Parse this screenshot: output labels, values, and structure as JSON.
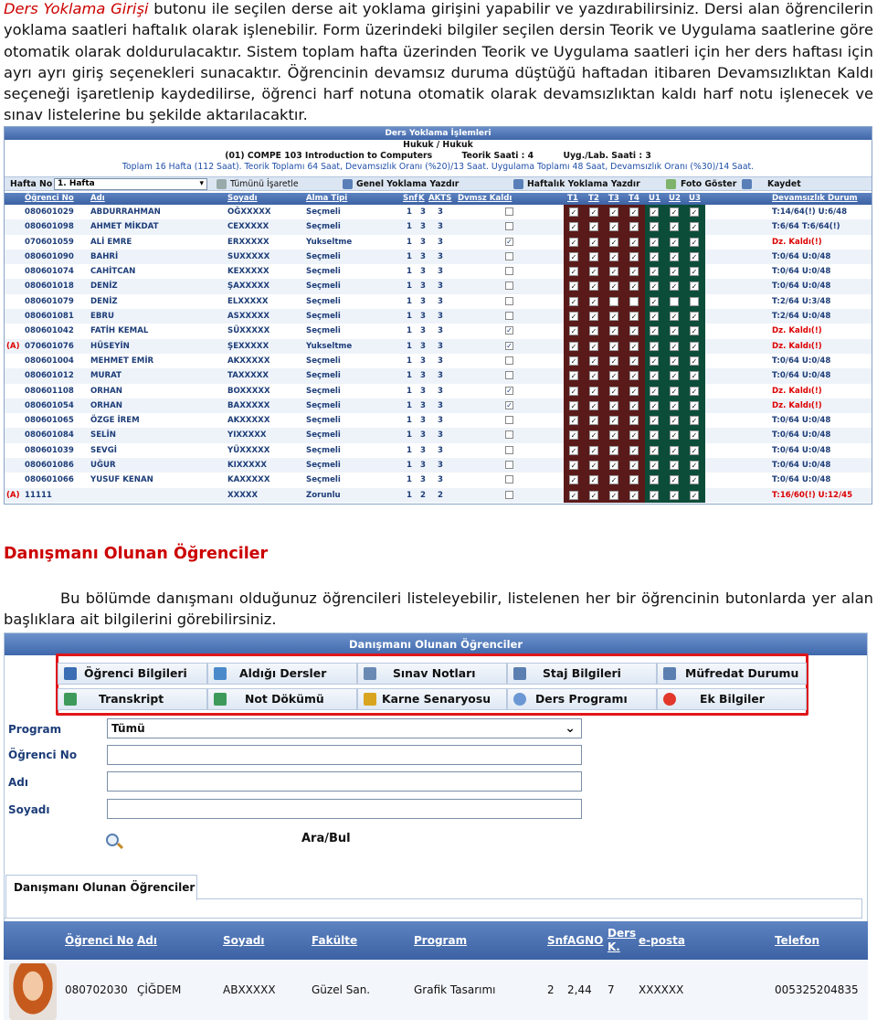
{
  "intro": {
    "lead_red": "Ders Yoklama Girişi",
    "text": " butonu ile seçilen derse ait yoklama girişini yapabilir ve yazdırabilirsiniz. Dersi alan öğrencilerin yoklama saatleri haftalık olarak işlenebilir. Form üzerindeki bilgiler seçilen dersin Teorik ve Uygulama saatlerine göre otomatik olarak doldurulacaktır. Sistem toplam hafta üzerinden Teorik ve Uygulama saatleri için her ders haftası için ayrı ayrı giriş seçenekleri sunacaktır. Öğrencinin devamsız duruma düştüğü haftadan itibaren Devamsızlıktan Kaldı seçeneği işaretlenip kaydedilirse, öğrenci harf notuna otomatik olarak devamsızlıktan kaldı harf notu işlenecek ve sınav listelerine bu şekilde aktarılacaktır."
  },
  "attendance_form": {
    "header": "Ders Yoklama İşlemleri",
    "line1": "Hukuk / Hukuk",
    "line2a": "(01) COMPE 103 Introduction to Computers",
    "line2b": "Teorik Saati : 4",
    "line2c": "Uyg./Lab. Saati : 3",
    "line3": "Toplam 16 Hafta (112 Saat). Teorik Toplamı 64 Saat, Devamsızlık Oranı (%20)/13 Saat. Uygulama Toplamı 48 Saat, Devamsızlık Oranı (%30)/14 Saat.",
    "week_label": "Hafta No",
    "week_value": "1. Hafta",
    "toolbar": {
      "mark_all": "Tümünü İşaretle",
      "general_print": "Genel Yoklama Yazdır",
      "weekly_print": "Haftalık Yoklama Yazdır",
      "photo": "Foto Göster",
      "save": "Kaydet"
    },
    "columns": {
      "no": "Öğrenci No",
      "name": "Adı",
      "surname": "Soyadı",
      "take_type": "Alma Tipi",
      "snf": "Snf",
      "k": "K",
      "akts": "AKTS",
      "dvmsz": "Dvmsz Kaldı",
      "t1": "T1",
      "t2": "T2",
      "t3": "T3",
      "t4": "T4",
      "u1": "U1",
      "u2": "U2",
      "u3": "U3",
      "status": "Devamsızlık Durum"
    },
    "rows": [
      {
        "no": "080601029",
        "name": "ABDURRAHMAN",
        "surname": "OĞXXXXX",
        "type": "Seçmeli",
        "snf": "1",
        "k": "3",
        "akts": "3",
        "dk": false,
        "checks": [
          1,
          1,
          1,
          1,
          1,
          1,
          1
        ],
        "status": "T:14/64(!) U:6/48",
        "red": false
      },
      {
        "no": "080601098",
        "name": "AHMET MİKDAT",
        "surname": "CEXXXXX",
        "type": "Seçmeli",
        "snf": "1",
        "k": "3",
        "akts": "3",
        "dk": false,
        "checks": [
          1,
          1,
          1,
          1,
          1,
          1,
          1
        ],
        "status": "T:6/64 T:6/64(!)",
        "red": false
      },
      {
        "no": "070601059",
        "name": "ALİ EMRE",
        "surname": "ERXXXXX",
        "type": "Yukseltme",
        "snf": "1",
        "k": "3",
        "akts": "3",
        "dk": true,
        "checks": [
          1,
          1,
          1,
          1,
          1,
          1,
          1
        ],
        "status": "Dz. Kaldı(!)",
        "red": true
      },
      {
        "no": "080601090",
        "name": "BAHRİ",
        "surname": "SUXXXXX",
        "type": "Seçmeli",
        "snf": "1",
        "k": "3",
        "akts": "3",
        "dk": false,
        "checks": [
          1,
          1,
          1,
          1,
          1,
          1,
          1
        ],
        "status": "T:0/64 U:0/48",
        "red": false
      },
      {
        "no": "080601074",
        "name": "CAHİTCAN",
        "surname": "KEXXXXX",
        "type": "Seçmeli",
        "snf": "1",
        "k": "3",
        "akts": "3",
        "dk": false,
        "checks": [
          1,
          1,
          1,
          1,
          1,
          1,
          1
        ],
        "status": "T:0/64 U:0/48",
        "red": false
      },
      {
        "no": "080601018",
        "name": "DENİZ",
        "surname": "ŞAXXXXX",
        "type": "Seçmeli",
        "snf": "1",
        "k": "3",
        "akts": "3",
        "dk": false,
        "checks": [
          1,
          1,
          1,
          1,
          1,
          1,
          1
        ],
        "status": "T:0/64 U:0/48",
        "red": false
      },
      {
        "no": "080601079",
        "name": "DENİZ",
        "surname": "ELXXXXX",
        "type": "Seçmeli",
        "snf": "1",
        "k": "3",
        "akts": "3",
        "dk": false,
        "checks": [
          1,
          1,
          0,
          0,
          1,
          0,
          0
        ],
        "status": "T:2/64 U:3/48",
        "red": false
      },
      {
        "no": "080601081",
        "name": "EBRU",
        "surname": "ASXXXXX",
        "type": "Seçmeli",
        "snf": "1",
        "k": "3",
        "akts": "3",
        "dk": false,
        "checks": [
          1,
          1,
          1,
          1,
          1,
          1,
          1
        ],
        "status": "T:2/64 U:0/48",
        "red": false
      },
      {
        "no": "080601042",
        "name": "FATİH KEMAL",
        "surname": "SÜXXXXX",
        "type": "Seçmeli",
        "snf": "1",
        "k": "3",
        "akts": "3",
        "dk": true,
        "checks": [
          1,
          1,
          1,
          1,
          1,
          1,
          1
        ],
        "status": "Dz. Kaldı(!)",
        "red": true
      },
      {
        "no": "070601076",
        "name": "HÜSEYİN",
        "surname": "ŞEXXXXX",
        "type": "Yukseltme",
        "snf": "1",
        "k": "3",
        "akts": "3",
        "dk": true,
        "checks": [
          1,
          1,
          1,
          1,
          1,
          1,
          1
        ],
        "status": "Dz. Kaldı(!)",
        "red": true,
        "prefix": "(A) "
      },
      {
        "no": "080601004",
        "name": "MEHMET EMİR",
        "surname": "AKXXXXX",
        "type": "Seçmeli",
        "snf": "1",
        "k": "3",
        "akts": "3",
        "dk": false,
        "checks": [
          1,
          1,
          1,
          1,
          1,
          1,
          1
        ],
        "status": "T:0/64 U:0/48",
        "red": false
      },
      {
        "no": "080601012",
        "name": "MURAT",
        "surname": "TAXXXXX",
        "type": "Seçmeli",
        "snf": "1",
        "k": "3",
        "akts": "3",
        "dk": false,
        "checks": [
          1,
          1,
          1,
          1,
          1,
          1,
          1
        ],
        "status": "T:0/64 U:0/48",
        "red": false
      },
      {
        "no": "080601108",
        "name": "ORHAN",
        "surname": "BOXXXXX",
        "type": "Seçmeli",
        "snf": "1",
        "k": "3",
        "akts": "3",
        "dk": true,
        "checks": [
          1,
          1,
          1,
          1,
          1,
          1,
          1
        ],
        "status": "Dz. Kaldı(!)",
        "red": true
      },
      {
        "no": "080601054",
        "name": "ORHAN",
        "surname": "BAXXXXX",
        "type": "Seçmeli",
        "snf": "1",
        "k": "3",
        "akts": "3",
        "dk": true,
        "checks": [
          1,
          1,
          1,
          1,
          1,
          1,
          1
        ],
        "status": "Dz. Kaldı(!)",
        "red": true
      },
      {
        "no": "080601065",
        "name": "ÖZGE İREM",
        "surname": "AKXXXXX",
        "type": "Seçmeli",
        "snf": "1",
        "k": "3",
        "akts": "3",
        "dk": false,
        "checks": [
          1,
          1,
          1,
          1,
          1,
          1,
          1
        ],
        "status": "T:0/64 U:0/48",
        "red": false
      },
      {
        "no": "080601084",
        "name": "SELİN",
        "surname": "YIXXXXX",
        "type": "Seçmeli",
        "snf": "1",
        "k": "3",
        "akts": "3",
        "dk": false,
        "checks": [
          1,
          1,
          1,
          1,
          1,
          1,
          1
        ],
        "status": "T:0/64 U:0/48",
        "red": false
      },
      {
        "no": "080601039",
        "name": "SEVGİ",
        "surname": "YÜXXXXX",
        "type": "Seçmeli",
        "snf": "1",
        "k": "3",
        "akts": "3",
        "dk": false,
        "checks": [
          1,
          1,
          1,
          1,
          1,
          1,
          1
        ],
        "status": "T:0/64 U:0/48",
        "red": false
      },
      {
        "no": "080601086",
        "name": "UĞUR",
        "surname": "KIXXXXX",
        "type": "Seçmeli",
        "snf": "1",
        "k": "3",
        "akts": "3",
        "dk": false,
        "checks": [
          1,
          1,
          1,
          1,
          1,
          1,
          1
        ],
        "status": "T:0/64 U:0/48",
        "red": false
      },
      {
        "no": "080601066",
        "name": "YUSUF KENAN",
        "surname": "KAXXXXX",
        "type": "Seçmeli",
        "snf": "1",
        "k": "3",
        "akts": "3",
        "dk": false,
        "checks": [
          1,
          1,
          1,
          1,
          1,
          1,
          1
        ],
        "status": "T:0/64 U:0/48",
        "red": false
      },
      {
        "no": "11111",
        "name": "",
        "surname": "XXXXX",
        "type": "Zorunlu",
        "snf": "1",
        "k": "2",
        "akts": "2",
        "dk": false,
        "checks": [
          1,
          1,
          1,
          1,
          1,
          1,
          1
        ],
        "status": "T:16/60(!) U:12/45",
        "red": true,
        "prefix": "(A) "
      }
    ]
  },
  "section2": {
    "heading": "Danışmanı Olunan Öğrenciler",
    "text": "Bu bölümde danışmanı olduğunuz öğrencileri listeleyebilir, listelenen her bir öğrencinin butonlarda yer alan başlıklara ait bilgilerini görebilirsiniz."
  },
  "advisor_form": {
    "header": "Danışmanı Olunan Öğrenciler",
    "buttons": [
      "Öğrenci Bilgileri",
      "Aldığı Dersler",
      "Sınav Notları",
      "Staj Bilgileri",
      "Müfredat Durumu",
      "Transkript",
      "Not Dökümü",
      "Karne Senaryosu",
      "Ders Programı",
      "Ek Bilgiler"
    ],
    "labels": {
      "program": "Program",
      "student_no": "Öğrenci No",
      "name": "Adı",
      "surname": "Soyadı"
    },
    "program_value": "Tümü",
    "search_label": "Ara/Bul",
    "tab_label": "Danışmanı Olunan Öğrenciler",
    "columns": {
      "no": "Öğrenci No",
      "name": "Adı",
      "surname": "Soyadı",
      "faculty": "Fakülte",
      "program": "Program",
      "snf": "Snf",
      "agno": "AGNO",
      "ders_k1": "Ders",
      "ders_k2": "K.",
      "email": "e-posta",
      "phone": "Telefon"
    },
    "row": {
      "no": "080702030",
      "name": "ÇİĞDEM",
      "surname": "ABXXXXX",
      "faculty": "Güzel San.",
      "program": "Grafik Tasarımı",
      "snf": "2",
      "agno": "2,44",
      "ders_k": "7",
      "email": "XXXXXX",
      "phone": "005325204835"
    }
  }
}
